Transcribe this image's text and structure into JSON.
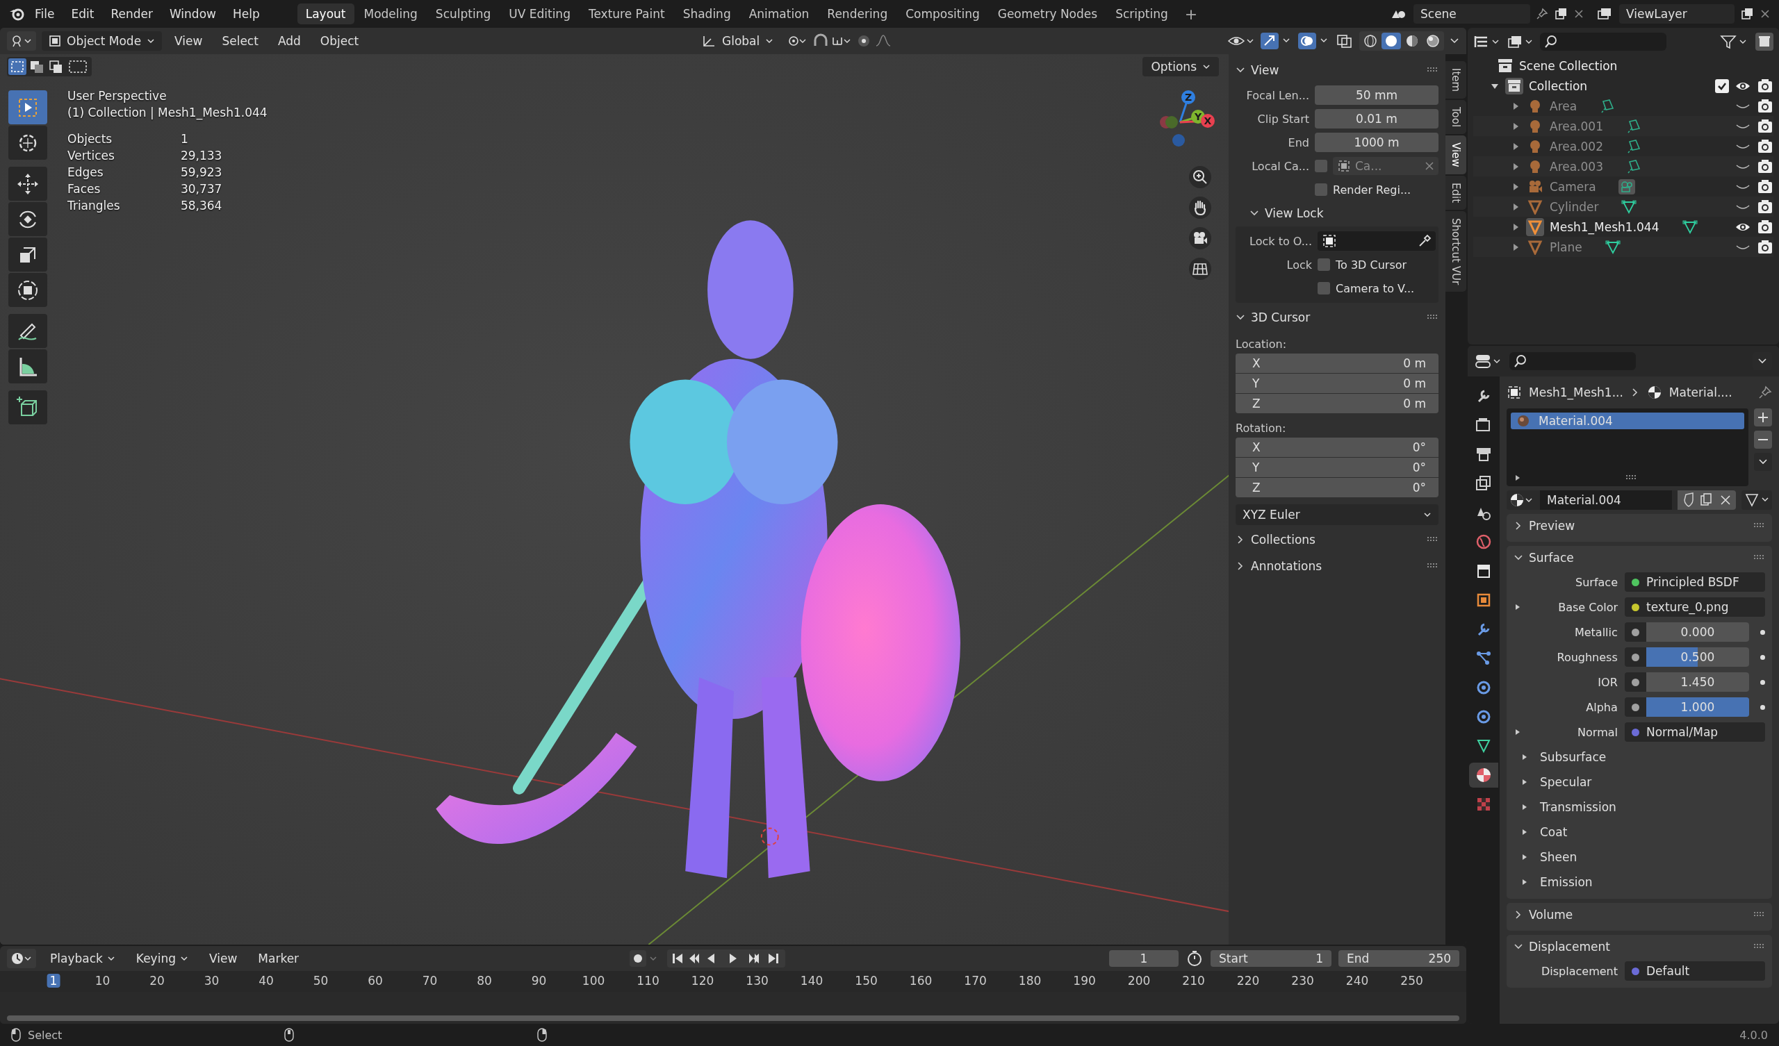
{
  "top_bar": {
    "menus": [
      "File",
      "Edit",
      "Render",
      "Window",
      "Help"
    ],
    "workspaces": [
      {
        "label": "Layout",
        "selected": true
      },
      {
        "label": "Modeling",
        "selected": false
      },
      {
        "label": "Sculpting",
        "selected": false
      },
      {
        "label": "UV Editing",
        "selected": false
      },
      {
        "label": "Texture Paint",
        "selected": false
      },
      {
        "label": "Shading",
        "selected": false
      },
      {
        "label": "Animation",
        "selected": false
      },
      {
        "label": "Rendering",
        "selected": false
      },
      {
        "label": "Compositing",
        "selected": false
      },
      {
        "label": "Geometry Nodes",
        "selected": false
      },
      {
        "label": "Scripting",
        "selected": false
      }
    ],
    "add_tab": "+",
    "scene": "Scene",
    "view_layer": "ViewLayer"
  },
  "viewport": {
    "header": {
      "mode": "Object Mode",
      "menus": [
        "View",
        "Select",
        "Add",
        "Object"
      ],
      "orientation": "Global",
      "shading": [
        {
          "kind": "wireframe",
          "selected": false
        },
        {
          "kind": "solid",
          "selected": true
        },
        {
          "kind": "material",
          "selected": false
        },
        {
          "kind": "rendered",
          "selected": false
        }
      ]
    },
    "options": "Options",
    "tools": [
      {
        "kind": "select",
        "selected": true
      },
      {
        "kind": "cursor",
        "selected": false
      },
      {
        "kind": "move",
        "selected": false
      },
      {
        "kind": "rotate",
        "selected": false
      },
      {
        "kind": "scale",
        "selected": false
      },
      {
        "kind": "transform",
        "selected": false
      },
      {
        "kind": "annotate",
        "selected": false
      },
      {
        "kind": "measure",
        "selected": false
      },
      {
        "kind": "add_cube",
        "selected": false
      }
    ],
    "overlay": {
      "view_name": "User Perspective",
      "context": "(1) Collection | Mesh1_Mesh1.044",
      "stats": [
        {
          "label": "Objects",
          "value": "1"
        },
        {
          "label": "Vertices",
          "value": "29,133"
        },
        {
          "label": "Edges",
          "value": "59,923"
        },
        {
          "label": "Faces",
          "value": "30,737"
        },
        {
          "label": "Triangles",
          "value": "58,364"
        }
      ]
    },
    "gizmo": {
      "axes": [
        {
          "label": "Z",
          "color": "#2f7fe0"
        },
        {
          "label": "Y",
          "color": "#7fb52e"
        },
        {
          "label": "X",
          "color": "#e8404f"
        }
      ]
    }
  },
  "sidebar": {
    "tabs": [
      {
        "label": "Item",
        "selected": false
      },
      {
        "label": "Tool",
        "selected": false
      },
      {
        "label": "View",
        "selected": true
      },
      {
        "label": "Edit",
        "selected": false
      },
      {
        "label": "Shortcut VUr",
        "selected": false
      }
    ],
    "sections": [
      {
        "title": "View",
        "expanded": true,
        "rows": [
          {
            "kind": "field",
            "label": "Focal Len...",
            "value": "50 mm"
          },
          {
            "kind": "field",
            "label": "Clip Start",
            "value": "0.01 m"
          },
          {
            "kind": "field",
            "label": "End",
            "value": "1000 m"
          },
          {
            "kind": "checkfield",
            "label": "Local Ca...",
            "checked": false,
            "placeholder": "Ca..."
          },
          {
            "kind": "check",
            "label": "Render Regi...",
            "checked": false
          }
        ],
        "subsection": {
          "title": "View Lock",
          "expanded": true,
          "rows": [
            {
              "kind": "objectfield",
              "label": "Lock to O..."
            },
            {
              "kind": "check",
              "lead": "Lock",
              "label": "To 3D Cursor",
              "checked": false
            },
            {
              "kind": "check",
              "label": "Camera to V...",
              "checked": false
            }
          ]
        }
      },
      {
        "title": "3D Cursor",
        "expanded": true,
        "groups": [
          {
            "label": "Location:",
            "axes": [
              {
                "axis": "X",
                "value": "0 m"
              },
              {
                "axis": "Y",
                "value": "0 m"
              },
              {
                "axis": "Z",
                "value": "0 m"
              }
            ]
          },
          {
            "label": "Rotation:",
            "axes": [
              {
                "axis": "X",
                "value": "0°"
              },
              {
                "axis": "Y",
                "value": "0°"
              },
              {
                "axis": "Z",
                "value": "0°"
              }
            ]
          }
        ],
        "dropdown": "XYZ Euler"
      },
      {
        "title": "Collections",
        "expanded": false
      },
      {
        "title": "Annotations",
        "expanded": false
      }
    ]
  },
  "outliner": {
    "root": "Scene Collection",
    "items": [
      {
        "name": "Collection",
        "kind": "collection",
        "expanded": true,
        "checked": true,
        "visible": true,
        "active": true,
        "children": [
          {
            "name": "Area",
            "kind": "light",
            "expanded": false,
            "visible": false,
            "active": false
          },
          {
            "name": "Area.001",
            "kind": "light",
            "expanded": false,
            "visible": false,
            "active": false
          },
          {
            "name": "Area.002",
            "kind": "light",
            "expanded": false,
            "visible": false,
            "active": false
          },
          {
            "name": "Area.003",
            "kind": "light",
            "expanded": false,
            "visible": false,
            "active": false
          },
          {
            "name": "Camera",
            "kind": "camera",
            "expanded": false,
            "visible": false,
            "active": false
          },
          {
            "name": "Cylinder",
            "kind": "mesh",
            "expanded": false,
            "visible": false,
            "active": false
          },
          {
            "name": "Mesh1_Mesh1.044",
            "kind": "mesh",
            "expanded": false,
            "visible": true,
            "active": true
          },
          {
            "name": "Plane",
            "kind": "mesh",
            "expanded": false,
            "visible": false,
            "active": false
          }
        ]
      }
    ]
  },
  "properties": {
    "tabs": [
      {
        "kind": "tool",
        "selected": false
      },
      {
        "kind": "render",
        "selected": false
      },
      {
        "kind": "output",
        "selected": false
      },
      {
        "kind": "view_layer",
        "selected": false
      },
      {
        "kind": "scene",
        "selected": false
      },
      {
        "kind": "world",
        "selected": false
      },
      {
        "kind": "collection",
        "selected": false
      },
      {
        "kind": "object",
        "selected": false
      },
      {
        "kind": "modifiers",
        "selected": false
      },
      {
        "kind": "particles",
        "selected": false
      },
      {
        "kind": "physics",
        "selected": false
      },
      {
        "kind": "constraints",
        "selected": false
      },
      {
        "kind": "data",
        "selected": false
      },
      {
        "kind": "material",
        "selected": true
      },
      {
        "kind": "texture",
        "selected": false
      }
    ],
    "breadcrumb": [
      "Mesh1_Mesh1...",
      "Material...."
    ],
    "slots": [
      {
        "name": "Material.004",
        "selected": true
      }
    ],
    "material_name": "Material.004",
    "panels": [
      {
        "title": "Preview",
        "expanded": false
      },
      {
        "title": "Surface",
        "expanded": true,
        "rows": [
          {
            "kind": "socket",
            "label": "Surface",
            "value": "Principled BSDF",
            "color": "#4fc45f",
            "expandable": false
          },
          {
            "kind": "socket",
            "label": "Base Color",
            "value": "texture_0.png",
            "color": "#c7c72e",
            "expandable": true
          },
          {
            "kind": "slider",
            "label": "Metallic",
            "value": "0.000",
            "level": 0
          },
          {
            "kind": "slider",
            "label": "Roughness",
            "value": "0.500",
            "level": 0.5
          },
          {
            "kind": "number",
            "label": "IOR",
            "value": "1.450"
          },
          {
            "kind": "slider",
            "label": "Alpha",
            "value": "1.000",
            "level": 1
          },
          {
            "kind": "socket",
            "label": "Normal",
            "value": "Normal/Map",
            "color": "#6b6bd6",
            "expandable": true
          },
          {
            "kind": "group",
            "label": "Subsurface"
          },
          {
            "kind": "group",
            "label": "Specular"
          },
          {
            "kind": "group",
            "label": "Transmission"
          },
          {
            "kind": "group",
            "label": "Coat"
          },
          {
            "kind": "group",
            "label": "Sheen"
          },
          {
            "kind": "group",
            "label": "Emission"
          }
        ]
      },
      {
        "title": "Volume",
        "expanded": false
      },
      {
        "title": "Displacement",
        "expanded": true,
        "rows": [
          {
            "kind": "socket",
            "label": "Displacement",
            "value": "Default",
            "color": "#6b6bd6",
            "expandable": false
          }
        ]
      }
    ]
  },
  "timeline": {
    "menus": [
      "Playback",
      "Keying",
      "View",
      "Marker"
    ],
    "current_frame": "1",
    "start": {
      "label": "Start",
      "value": "1"
    },
    "end": {
      "label": "End",
      "value": "250"
    },
    "frames": [
      {
        "label": "1",
        "selected": true
      },
      {
        "label": "10",
        "selected": false
      },
      {
        "label": "20",
        "selected": false
      },
      {
        "label": "30",
        "selected": false
      },
      {
        "label": "40",
        "selected": false
      },
      {
        "label": "50",
        "selected": false
      },
      {
        "label": "60",
        "selected": false
      },
      {
        "label": "70",
        "selected": false
      },
      {
        "label": "80",
        "selected": false
      },
      {
        "label": "90",
        "selected": false
      },
      {
        "label": "100",
        "selected": false
      },
      {
        "label": "110",
        "selected": false
      },
      {
        "label": "120",
        "selected": false
      },
      {
        "label": "130",
        "selected": false
      },
      {
        "label": "140",
        "selected": false
      },
      {
        "label": "150",
        "selected": false
      },
      {
        "label": "160",
        "selected": false
      },
      {
        "label": "170",
        "selected": false
      },
      {
        "label": "180",
        "selected": false
      },
      {
        "label": "190",
        "selected": false
      },
      {
        "label": "200",
        "selected": false
      },
      {
        "label": "210",
        "selected": false
      },
      {
        "label": "220",
        "selected": false
      },
      {
        "label": "230",
        "selected": false
      },
      {
        "label": "240",
        "selected": false
      },
      {
        "label": "250",
        "selected": false
      }
    ]
  },
  "status_bar": {
    "action": "Select",
    "version": "4.0.0"
  }
}
